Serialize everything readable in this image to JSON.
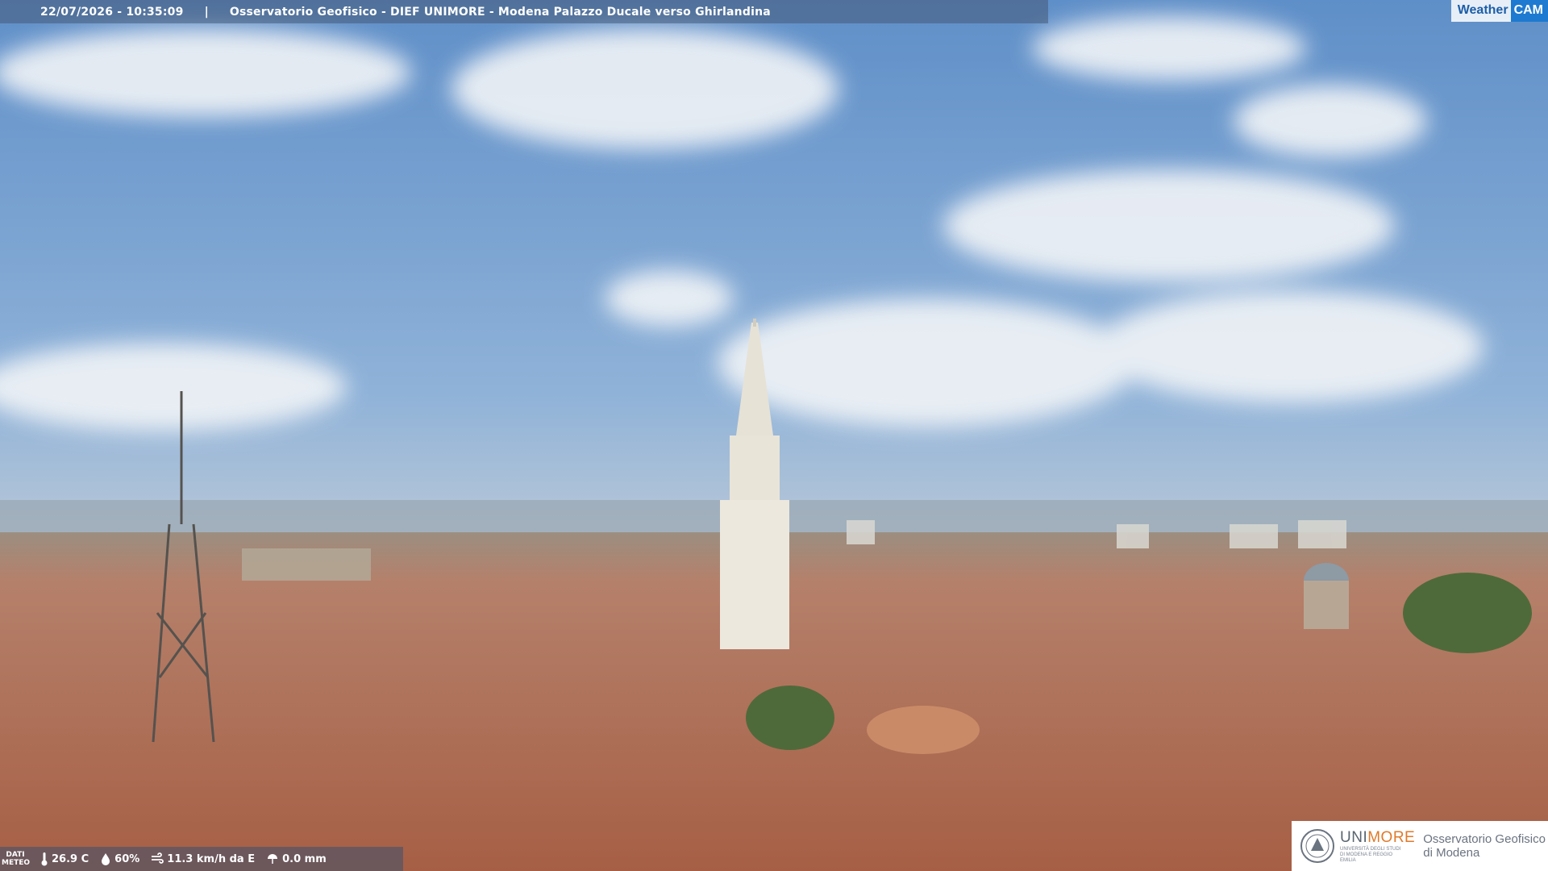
{
  "overlay": {
    "datetime": "22/07/2026 - 10:35:09",
    "separator": "|",
    "camera_title": "Osservatorio Geofisico - DIEF UNIMORE - Modena Palazzo Ducale verso Ghirlandina"
  },
  "brand": {
    "weather": "Weather",
    "cam": "CAM"
  },
  "weather_bar": {
    "label_line1": "DATI",
    "label_line2": "METEO",
    "temperature": "26.9 C",
    "humidity": "60%",
    "wind": "11.3 km/h da E",
    "rain": "0.0 mm",
    "icons": [
      "thermometer-icon",
      "humidity-drop-icon",
      "wind-icon",
      "rain-icon"
    ]
  },
  "logo": {
    "uni_prefix": "UNI",
    "uni_suffix": "MORE",
    "uni_subtitle": "UNIVERSITÀ DEGLI STUDI DI MODENA E REGGIO EMILIA",
    "observatory_line1": "Osservatorio Geofisico",
    "observatory_line2": "di Modena"
  },
  "colors": {
    "sky": "#8fb0d6",
    "roofs": "#b9785a",
    "accent": "#e07a2a",
    "brand_blue": "#1e7ad0"
  }
}
